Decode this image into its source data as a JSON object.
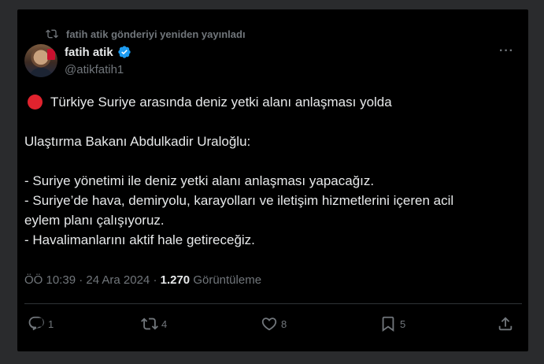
{
  "repost": {
    "label": "fatih atik gönderiyi yeniden yayınladı",
    "icon": "repost-icon"
  },
  "author": {
    "name": "fatih atik",
    "handle": "@atikfatih1",
    "verified": true,
    "verified_color": "#1d9bf0"
  },
  "post": {
    "headline": "Türkiye Suriye arasında deniz yetki alanı anlaşması yolda",
    "headline_icon": "red-circle-icon",
    "intro": "Ulaştırma Bakanı Abdulkadir Uraloğlu:",
    "bullets": [
      "- Suriye yönetimi ile deniz yetki alanı anlaşması yapacağız.",
      "- Suriye’de hava, demiryolu, karayolları ve iletişim hizmetlerini içeren acil",
      "eylem planı çalışıyoruz.",
      "- Havalimanlarını aktif hale getireceğiz."
    ]
  },
  "meta": {
    "time_date": "ÖÖ 10:39 · 24 Ara 2024 · ",
    "views_count": "1.270",
    "views_label": " Görüntüleme"
  },
  "actions": {
    "replies": "1",
    "reposts": "4",
    "likes": "8",
    "bookmarks": "5"
  },
  "colors": {
    "background": "#000000",
    "text": "#e7e9ea",
    "muted": "#71767b",
    "accent": "#1d9bf0",
    "red_dot": "#e0232e"
  }
}
